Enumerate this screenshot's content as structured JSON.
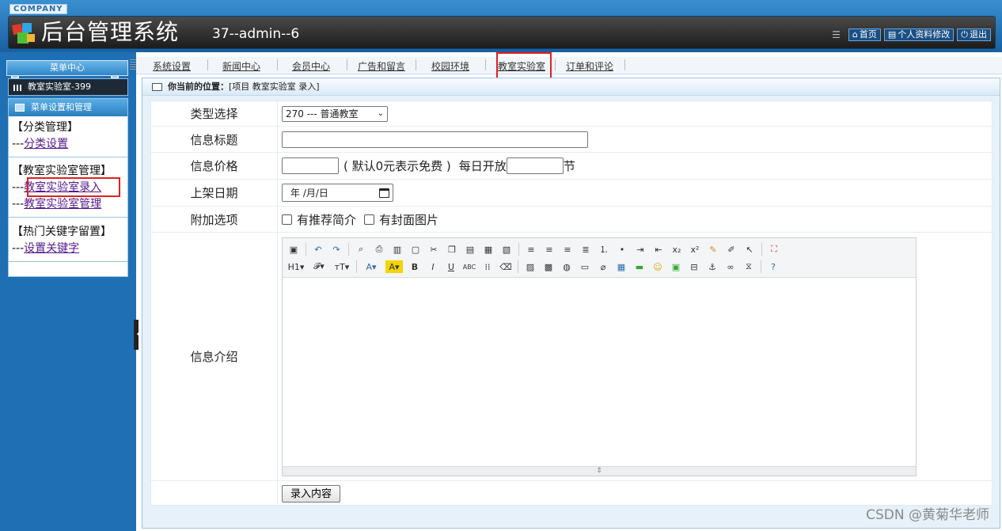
{
  "header": {
    "company": "COMPANY",
    "title": "后台管理系统",
    "user": "37--admin--6",
    "links": [
      {
        "icon": "home-icon",
        "label": "首页"
      },
      {
        "icon": "profile-icon",
        "label": "个人资料修改"
      },
      {
        "icon": "power-icon",
        "label": "退出"
      }
    ]
  },
  "sidebar": {
    "menu_center": "菜单中心",
    "current_module": "教室实验室-399",
    "box_title": "菜单设置和管理",
    "sections": [
      {
        "title": "【分类管理】",
        "links": [
          "分类设置"
        ]
      },
      {
        "title": "【教室实验室管理】",
        "links": [
          "教室实验室录入",
          "教室实验室管理"
        ]
      },
      {
        "title": "【热门关键字留置】",
        "links": [
          "设置关键字"
        ]
      }
    ],
    "dash": "---"
  },
  "nav": {
    "items": [
      "系统设置",
      "新闻中心",
      "会员中心",
      "广告和留言",
      "校园环境",
      "教室实验室",
      "订单和评论"
    ],
    "active": "教室实验室"
  },
  "breadcrumb": {
    "prefix": "你当前的位置：",
    "path": "[项目 教室实验室 录入]"
  },
  "form": {
    "type_label": "类型选择",
    "type_value": "270 --- 普通教室",
    "title_label": "信息标题",
    "price_label": "信息价格",
    "price_hint": "( 默认0元表示免费 )",
    "daily_open": "每日开放",
    "unit": "节",
    "date_label": "上架日期",
    "date_placeholder": "年 /月/日",
    "options_label": "附加选项",
    "opt_intro": "有推荐简介",
    "opt_cover": "有封面图片",
    "intro_label": "信息介绍",
    "submit": "录入内容"
  },
  "watermark": "CSDN @黄菊华老师",
  "colors": {
    "header": "#1a5fa0",
    "sidebar": "#1f6fb5",
    "highlight_box": "#e02020"
  }
}
